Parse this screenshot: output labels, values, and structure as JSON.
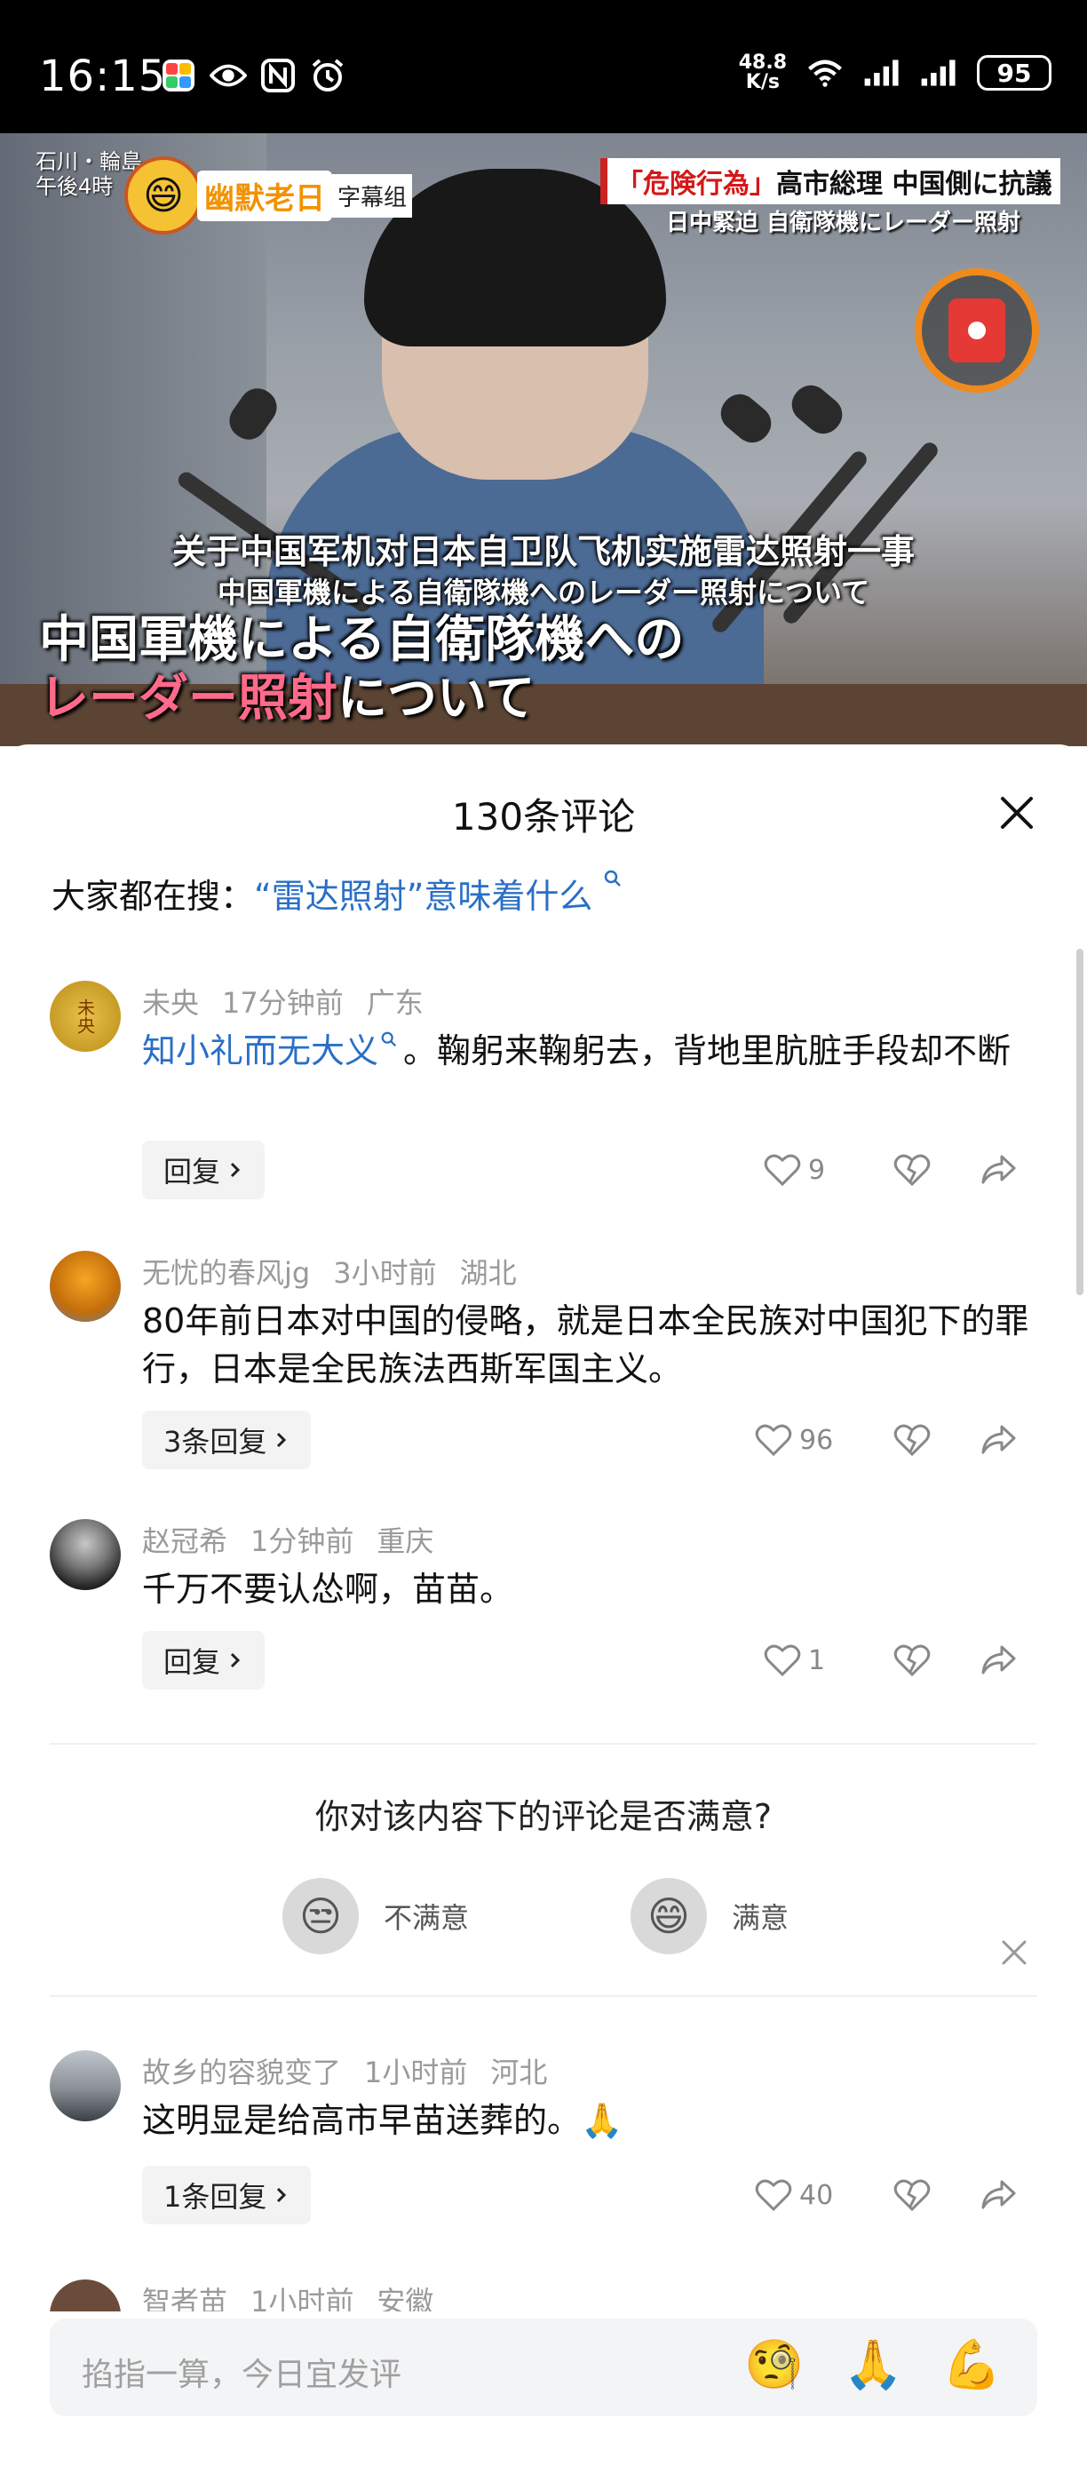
{
  "status": {
    "time": "16:15",
    "net_speed_value": "48.8",
    "net_speed_unit": "K/s",
    "battery": "95"
  },
  "video": {
    "corner_text_line1": "石川・輪島",
    "corner_text_line2": "午後4時",
    "logo_name": "幽默老日",
    "logo_sub": "字幕组",
    "banner_red": "「危険行為」",
    "banner_rest": "高市総理 中国側に抗議",
    "banner_sub": "日中緊迫 自衛隊機にレーダー照射",
    "subtitle_cn": "关于中国军机对日本自卫队飞机实施雷达照射一事",
    "subtitle_jp": "中国軍機による自衛隊機へのレーダー照射について",
    "caption_line1": "中国軍機による自衛隊機への",
    "caption_line2_red": "レーダー照射",
    "caption_line2_rest": "について"
  },
  "sheet": {
    "title": "130条评论",
    "search_prefix": "大家都在搜：",
    "search_link": "“雷达照射”意味着什么"
  },
  "comments": [
    {
      "user": "未央",
      "time": "17分钟前",
      "location": "广东",
      "keyword": "知小礼而无大义",
      "text": "。鞠躬来鞠躬去，背地里肮脏手段却不断",
      "reply_label": "回复",
      "likes": "9",
      "avatar_text": "未央"
    },
    {
      "user": "无忧的春风jg",
      "time": "3小时前",
      "location": "湖北",
      "text": "80年前日本对中国的侵略，就是日本全民族对中国犯下的罪行，日本是全民族法西斯军国主义。",
      "reply_label": "3条回复",
      "likes": "96"
    },
    {
      "user": "赵冠希",
      "time": "1分钟前",
      "location": "重庆",
      "text": "千万不要认怂啊，苗苗。",
      "reply_label": "回复",
      "likes": "1"
    },
    {
      "user": "故乡的容貌变了",
      "time": "1小时前",
      "location": "河北",
      "text": "这明显是给高市早苗送葬的。🙏",
      "reply_label": "1条回复",
      "likes": "40"
    },
    {
      "user": "智者苗",
      "time": "1小时前",
      "location": "安徽"
    }
  ],
  "survey": {
    "question": "你对该内容下的评论是否满意?",
    "option_bad": "不满意",
    "option_good": "满意"
  },
  "input": {
    "placeholder": "掐指一算，今日宜发评",
    "emoji1": "🧐",
    "emoji2": "🙏",
    "emoji3": "💪"
  }
}
